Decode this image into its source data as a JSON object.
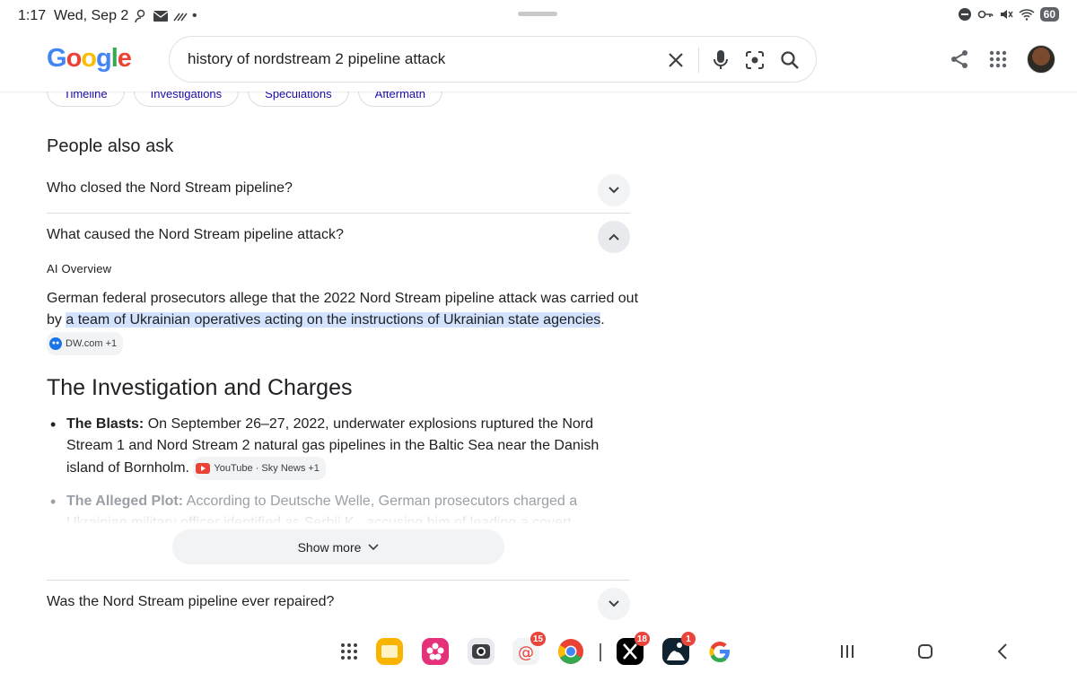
{
  "status": {
    "time": "1:17",
    "date": "Wed, Sep 2",
    "battery": "60"
  },
  "header": {
    "logo": "Google",
    "search_value": "history of nordstream 2 pipeline attack"
  },
  "chips": [
    "Timeline",
    "Investigations",
    "Speculations",
    "Aftermath"
  ],
  "paa": {
    "title": "People also ask",
    "questions": [
      "Who closed the Nord Stream pipeline?",
      "What caused the Nord Stream pipeline attack?",
      "Was the Nord Stream pipeline ever repaired?"
    ],
    "ai_label": "AI Overview",
    "para_before": "German federal prosecutors allege that the 2022 Nord Stream pipeline attack was carried out by ",
    "para_highlight": "a team of Ukrainian operatives acting on the instructions of Ukrainian state agencies",
    "para_after": ".",
    "para_source": "DW.com +1",
    "section_heading": "The Investigation and Charges",
    "bullet1_title": "The Blasts:",
    "bullet1_text": " On September 26–27, 2022, underwater explosions ruptured the Nord Stream 1 and Nord Stream 2 natural gas pipelines in the Baltic Sea near the Danish island of Bornholm.",
    "bullet1_source": "YouTube · Sky News +1",
    "bullet2_title": "The Alleged Plot:",
    "bullet2_text": " According to Deutsche Welle, German prosecutors charged a Ukrainian military officer identified as Serhii K., accusing him of leading a covert",
    "show_more": "Show more"
  },
  "taskbar": {
    "badges": {
      "mail": "15",
      "x": "18",
      "kindle": "1"
    }
  }
}
